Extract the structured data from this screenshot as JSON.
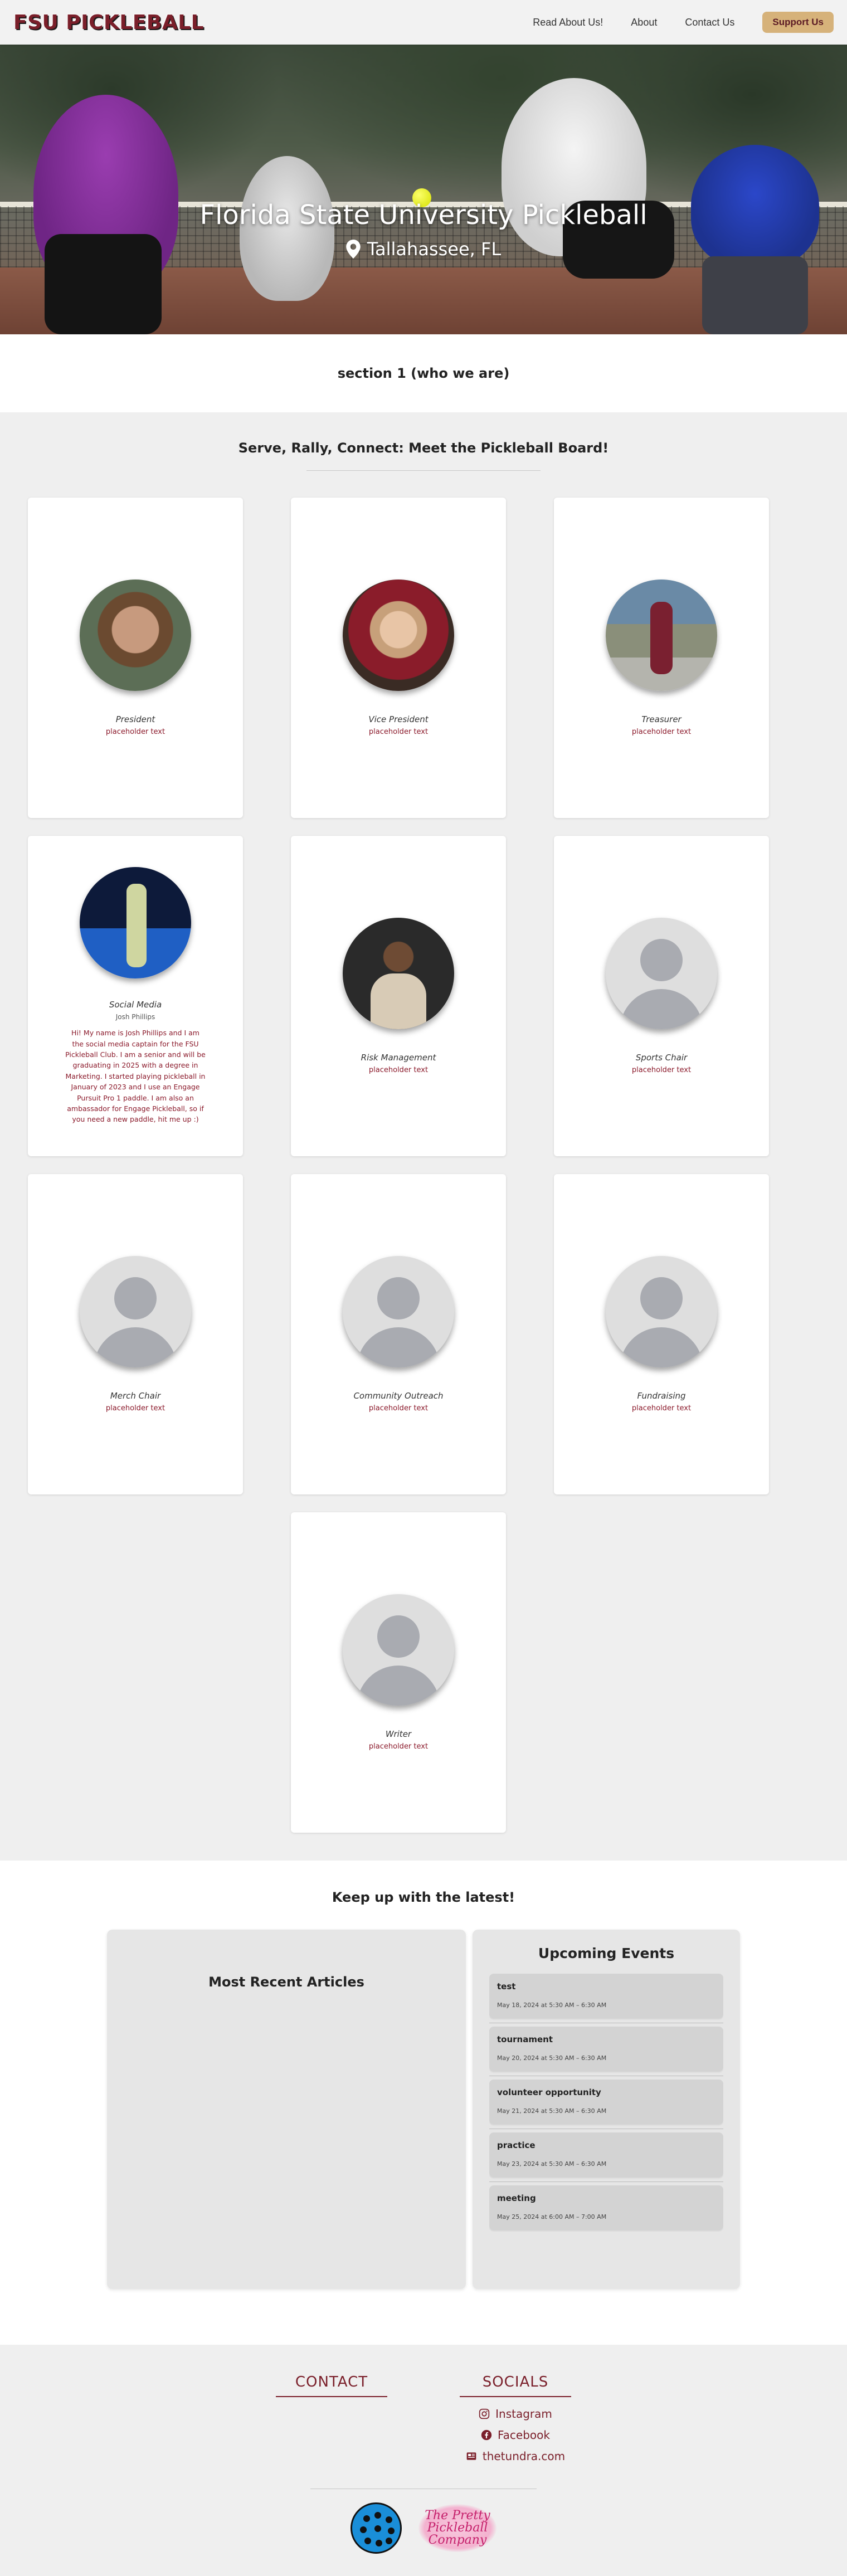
{
  "header": {
    "logo": "FSU PICKLEBALL",
    "nav": [
      "Read About Us!",
      "About",
      "Contact Us"
    ],
    "support": "Support Us",
    "colors": {
      "brand": "#7a1f2a",
      "support_bg": "#d6b27a"
    }
  },
  "hero": {
    "title": "Florida State University Pickleball",
    "location": "Tallahassee, FL"
  },
  "section1": {
    "title": "section 1 (who we are)"
  },
  "board": {
    "title": "Serve, Rally, Connect: Meet the Pickleball Board!",
    "members": [
      {
        "role": "President",
        "text": "placeholder text"
      },
      {
        "role": "Vice President",
        "text": "placeholder text"
      },
      {
        "role": "Treasurer",
        "text": "placeholder text"
      },
      {
        "role": "Social Media",
        "name": "Josh Phillips",
        "text": "Hi! My name is Josh Phillips and I am the social media captain for the FSU Pickleball Club. I am a senior and will be graduating in 2025 with a degree in Marketing. I started playing pickleball in January of 2023 and I use an Engage Pursuit Pro 1 paddle. I am also an ambassador for Engage Pickleball, so if you need a new paddle, hit me up :)"
      },
      {
        "role": "Risk Management",
        "text": "placeholder text"
      },
      {
        "role": "Sports Chair",
        "text": "placeholder text"
      },
      {
        "role": "Merch Chair",
        "text": "placeholder text"
      },
      {
        "role": "Community Outreach",
        "text": "placeholder text"
      },
      {
        "role": "Fundraising",
        "text": "placeholder text"
      },
      {
        "role": "Writer",
        "text": "placeholder text"
      }
    ]
  },
  "latest": {
    "title": "Keep up with the latest!",
    "articles_title": "Most Recent Articles",
    "events_title": "Upcoming Events",
    "events": [
      {
        "title": "test",
        "date": "May 18, 2024 at 5:30 AM – 6:30 AM"
      },
      {
        "title": "tournament",
        "date": "May 20, 2024 at 5:30 AM – 6:30 AM"
      },
      {
        "title": "volunteer opportunity",
        "date": "May 21, 2024 at 5:30 AM – 6:30 AM"
      },
      {
        "title": "practice",
        "date": "May 23, 2024 at 5:30 AM – 6:30 AM"
      },
      {
        "title": "meeting",
        "date": "May 25, 2024 at 6:00 AM – 7:00 AM"
      }
    ]
  },
  "footer": {
    "contact_title": "CONTACT",
    "socials_title": "SOCIALS",
    "socials": [
      "Instagram",
      "Facebook",
      "thetundra.com"
    ],
    "pretty_logo": "The Pretty Pickleball Company"
  }
}
